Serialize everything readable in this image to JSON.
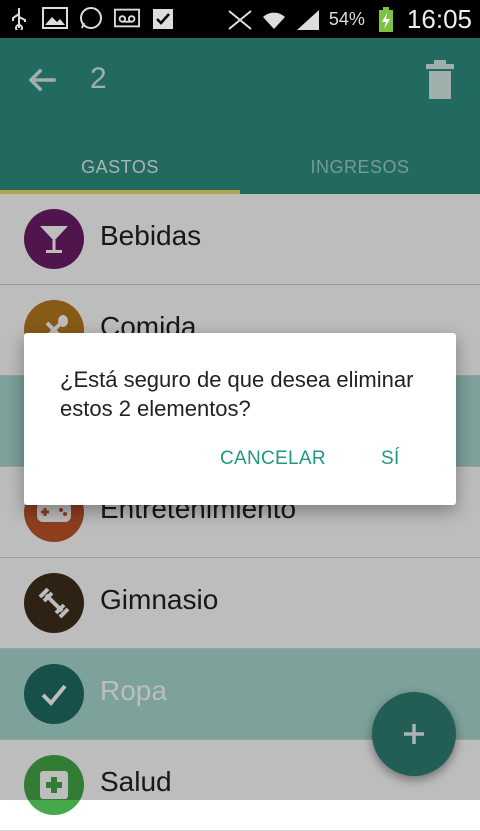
{
  "status_bar": {
    "icons": [
      "usb-icon",
      "image-icon",
      "whatsapp-icon",
      "voicemail-icon",
      "clipboard-check-icon",
      "mute-icon",
      "wifi-icon",
      "signal-icon",
      "battery-charging-icon"
    ],
    "battery_percent": "54%",
    "time": "16:05"
  },
  "app_bar": {
    "selected_count": "2",
    "tabs": [
      {
        "label": "GASTOS",
        "active": true
      },
      {
        "label": "INGRESOS",
        "active": false
      }
    ]
  },
  "categories": [
    {
      "label": "Bebidas",
      "icon": "cocktail-icon",
      "color": "#6e1d6a",
      "selected": false
    },
    {
      "label": "Comida",
      "icon": "fork-spoon-icon",
      "color": "#b77a1f",
      "selected": false
    },
    {
      "label": "",
      "icon": "",
      "color": "#2e8f80",
      "selected": true
    },
    {
      "label": "Entretenimiento",
      "icon": "gamepad-icon",
      "color": "#c0542a",
      "selected": false
    },
    {
      "label": "Gimnasio",
      "icon": "dumbbell-icon",
      "color": "#3f2f1c",
      "selected": false
    },
    {
      "label": "Ropa",
      "icon": "check-icon",
      "color": "#1f6c62",
      "selected": true
    },
    {
      "label": "Salud",
      "icon": "medical-cross-icon",
      "color": "#45a84a",
      "selected": false
    }
  ],
  "dialog": {
    "message": "¿Está seguro de que desea eliminar estos 2 elementos?",
    "cancel_label": "CANCELAR",
    "confirm_label": "SÍ"
  },
  "colors": {
    "primary": "#2e8f80",
    "accent_underline": "#f1dd6b",
    "dialog_button": "#229685"
  }
}
